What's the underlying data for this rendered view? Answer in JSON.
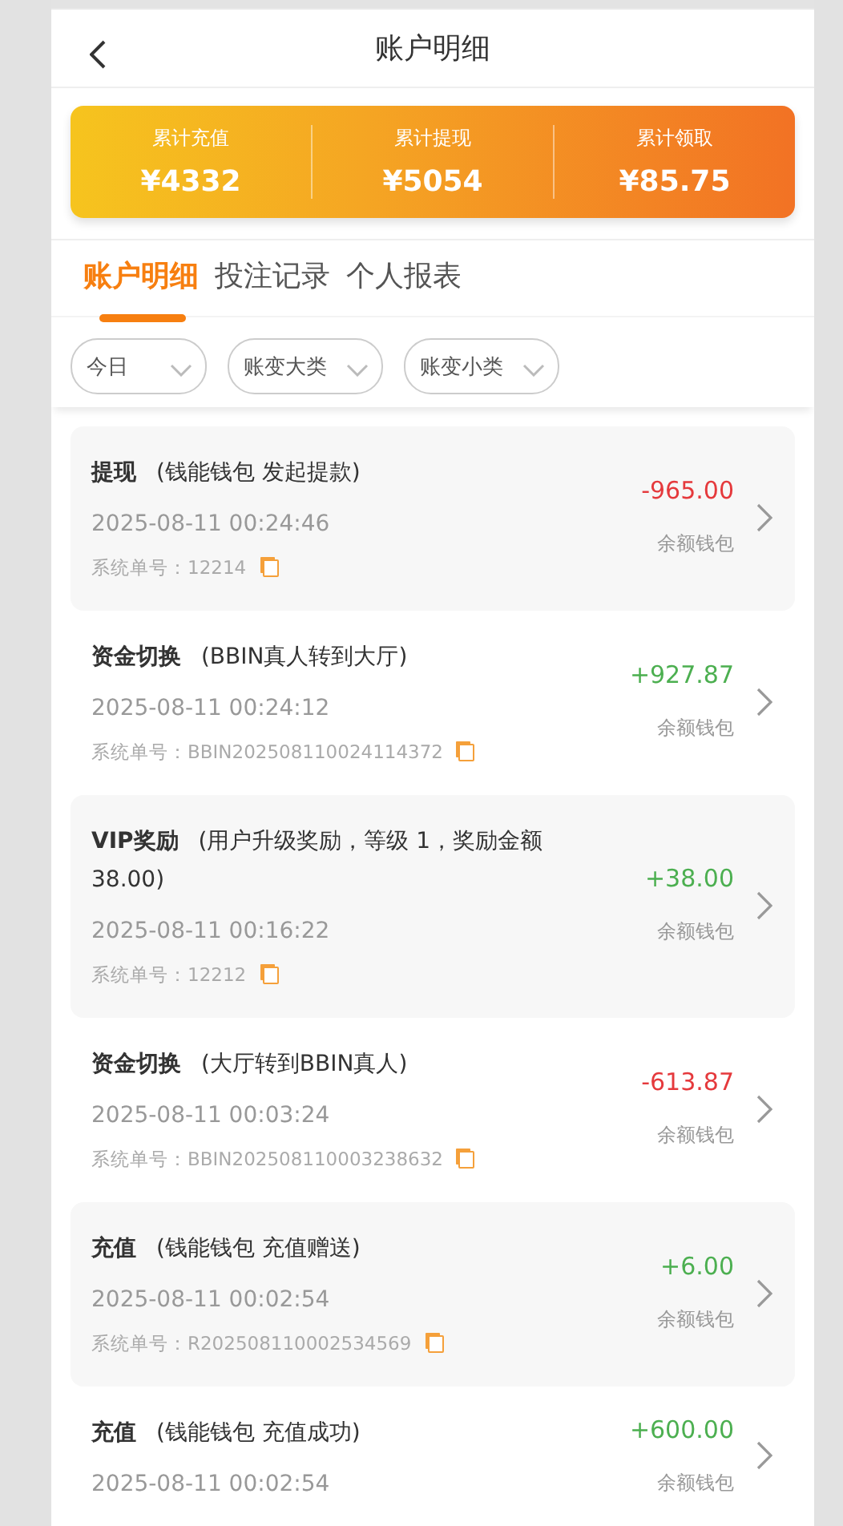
{
  "header": {
    "title": "账户明细"
  },
  "summary": [
    {
      "label": "累计充值",
      "value": "¥4332"
    },
    {
      "label": "累计提现",
      "value": "¥5054"
    },
    {
      "label": "累计领取",
      "value": "¥85.75"
    }
  ],
  "tabs": [
    {
      "label": "账户明细",
      "selected": true
    },
    {
      "label": "投注记录",
      "selected": false
    },
    {
      "label": "个人报表",
      "selected": false
    }
  ],
  "filters": [
    {
      "label": "今日"
    },
    {
      "label": "账变大类"
    },
    {
      "label": "账变小类"
    }
  ],
  "records": [
    {
      "title": "**提现** (钱能钱包 发起提款)",
      "time": "2025-08-11 00:24:46",
      "order": "系统单号：12214",
      "amount": "-965.00",
      "color": "#e5393c",
      "wallet": "余额钱包"
    },
    {
      "title": "**资金切换** (BBIN真人转到大厅)",
      "time": "2025-08-11 00:24:12",
      "order": "系统单号：BBIN202508110024114372",
      "amount": "+927.87",
      "color": "#4caf50",
      "wallet": "余额钱包"
    },
    {
      "title": "**VIP奖励** (用户升级奖励，等级 1，奖励金额 38.00)",
      "time": "2025-08-11 00:16:22",
      "order": "系统单号：12212",
      "amount": "+38.00",
      "color": "#4caf50",
      "wallet": "余额钱包"
    },
    {
      "title": "**资金切换** (大厅转到BBIN真人)",
      "time": "2025-08-11 00:03:24",
      "order": "系统单号：BBIN202508110003238632",
      "amount": "-613.87",
      "color": "#e5393c",
      "wallet": "余额钱包"
    },
    {
      "title": "**充值** (钱能钱包 充值赠送)",
      "time": "2025-08-11 00:02:54",
      "order": "系统单号：R202508110002534569",
      "amount": "+6.00",
      "color": "#4caf50",
      "wallet": "余额钱包"
    },
    {
      "title": "**充值** (钱能钱包 充值成功)",
      "time": "2025-08-11 00:02:54",
      "amount": "+600.00",
      "color": "#4caf50",
      "wallet": "余额钱包"
    }
  ]
}
